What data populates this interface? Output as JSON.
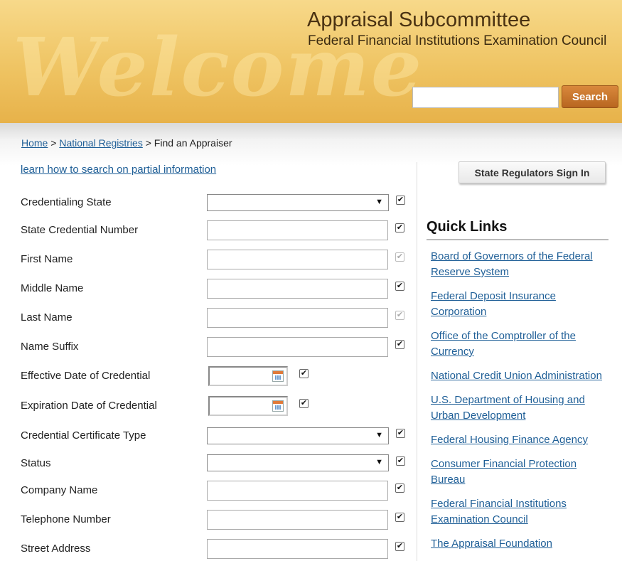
{
  "header": {
    "watermark": "Welcome",
    "title": "Appraisal Subcommittee",
    "subtitle": "Federal Financial Institutions Examination Council",
    "search_placeholder": "",
    "search_label": "Search"
  },
  "breadcrumb": {
    "home": "Home",
    "sep1": ">",
    "registries": "National Registries",
    "sep2": ">",
    "current": "Find an Appraiser"
  },
  "partial_link": "learn how to search on partial information",
  "form": {
    "credentialing_state": "Credentialing State",
    "state_credential_number": "State Credential Number",
    "first_name": "First Name",
    "middle_name": "Middle Name",
    "last_name": "Last Name",
    "name_suffix": "Name Suffix",
    "effective_date": "Effective Date of Credential",
    "expiration_date": "Expiration Date of Credential",
    "certificate_type": "Credential Certificate Type",
    "status": "Status",
    "company_name": "Company Name",
    "telephone_number": "Telephone Number",
    "street_address": "Street Address",
    "select_arrow": "▼",
    "check_mark": "✔"
  },
  "sidebar": {
    "regulators_button": "State Regulators Sign In",
    "quick_links_title": "Quick Links",
    "links": [
      "Board of Governors of the Federal Reserve System",
      "Federal Deposit Insurance Corporation",
      "Office of the Comptroller of the Currency",
      "National Credit Union Administration",
      "U.S. Department of Housing and Urban Development",
      "Federal Housing Finance Agency",
      "Consumer Financial Protection Bureau",
      "Federal Financial Institutions Examination Council",
      "The Appraisal Foundation"
    ]
  },
  "colors": {
    "link": "#1f5f97",
    "header_gold": "#efc463",
    "search_button": "#c8772c"
  },
  "icons": {
    "calendar": "calendar-icon",
    "checkbox": "checkbox-checked-icon",
    "dropdown": "chevron-down-icon"
  }
}
